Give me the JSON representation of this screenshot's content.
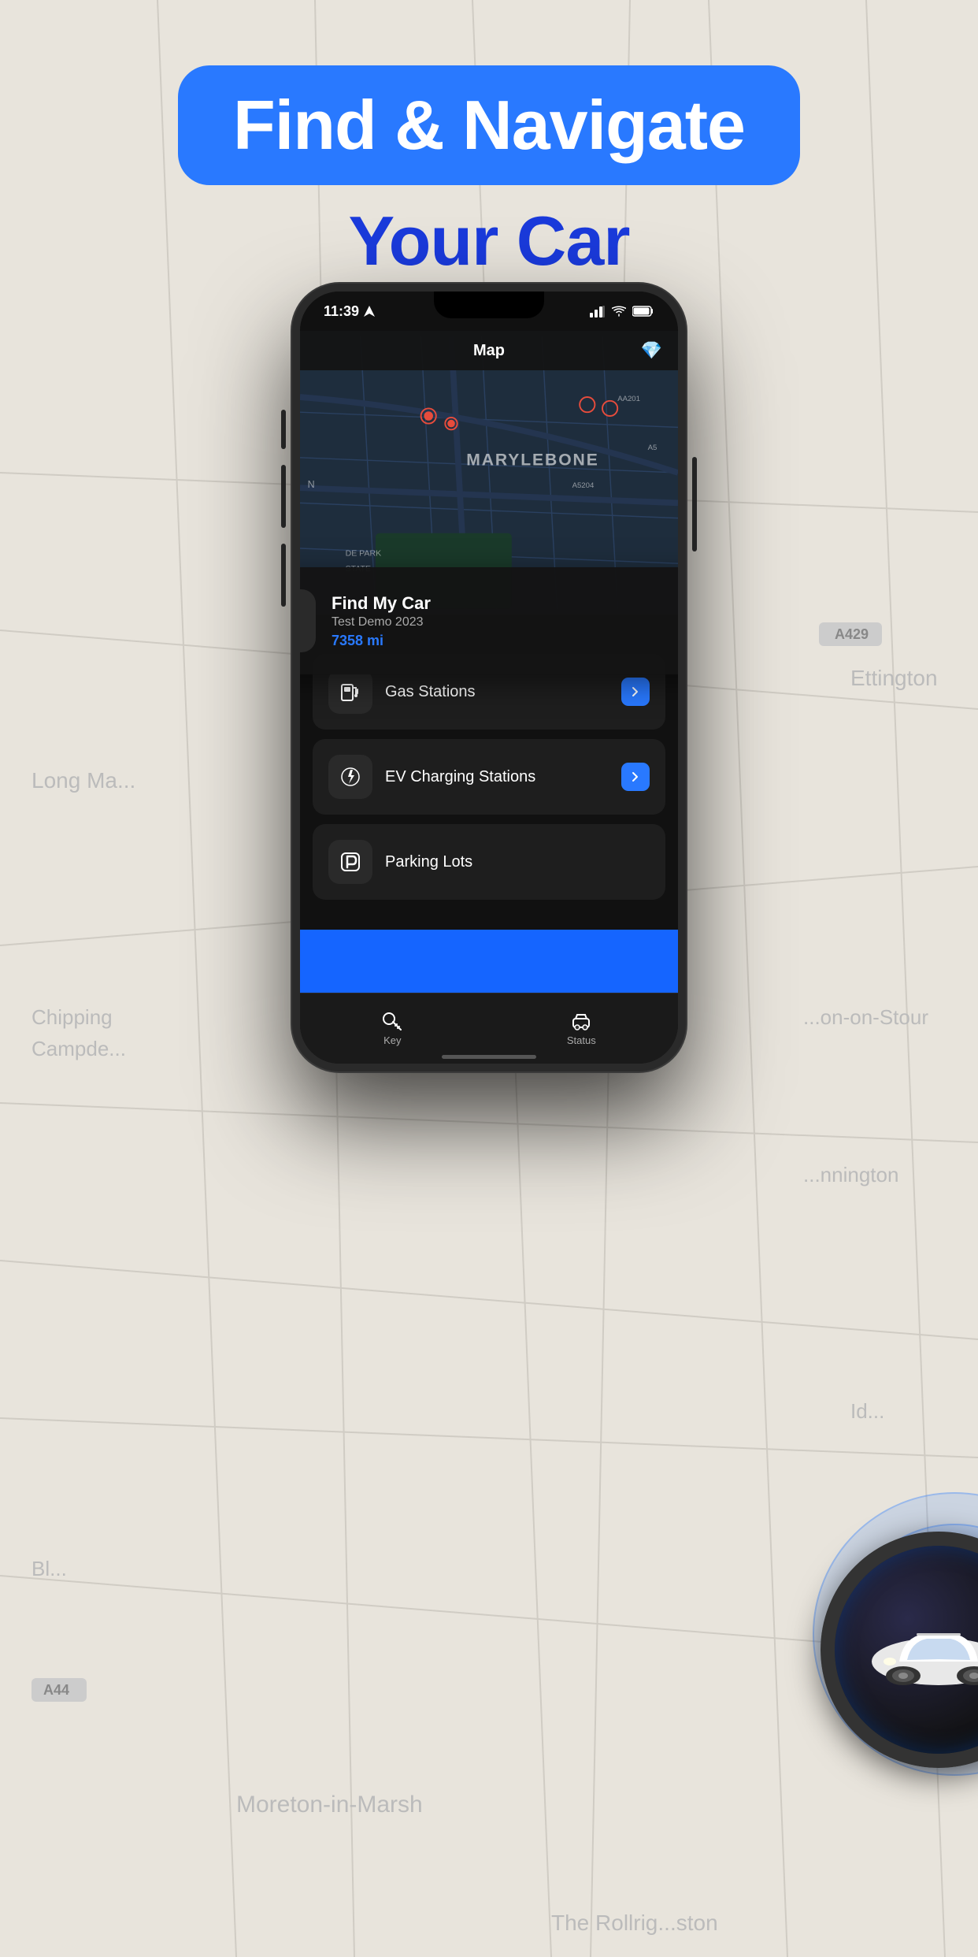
{
  "header": {
    "title_line1": "Find & Navigate",
    "title_line2": "Your Car"
  },
  "phone": {
    "status_bar": {
      "time": "11:39",
      "signal": "●●",
      "wifi": "wifi",
      "battery": "battery"
    },
    "nav": {
      "title": "Map",
      "gem_icon": "💎"
    },
    "map": {
      "label": "MARYLEBONE"
    },
    "find_my_car": {
      "title": "Find My Car",
      "subtitle": "Test Demo 2023",
      "distance": "7358 mi"
    },
    "menu_items": [
      {
        "label": "Gas Stations",
        "icon": "gas"
      },
      {
        "label": "EV Charging Stations",
        "icon": "ev"
      },
      {
        "label": "Parking Lots",
        "icon": "parking"
      }
    ],
    "bottom_nav": [
      {
        "label": "Key",
        "icon": "key"
      },
      {
        "label": "Status",
        "icon": "car"
      }
    ]
  }
}
